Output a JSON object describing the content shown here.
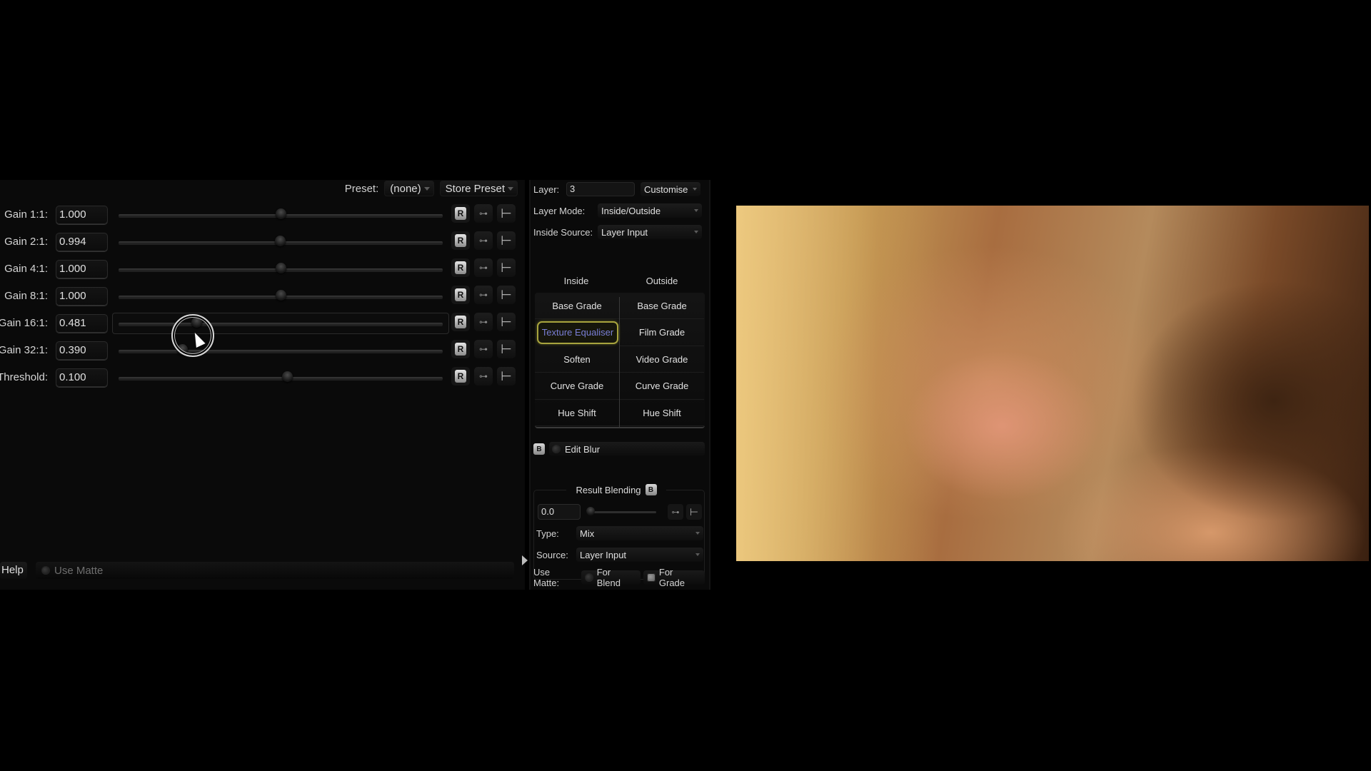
{
  "effect_panel": {
    "preset_label": "Preset:",
    "preset_value": "(none)",
    "store_preset_label": "Store Preset",
    "params": [
      {
        "label": "Gain 1:1:",
        "value": "1.000",
        "slider_fraction": 0.5
      },
      {
        "label": "Gain 2:1:",
        "value": "0.994",
        "slider_fraction": 0.497
      },
      {
        "label": "Gain 4:1:",
        "value": "1.000",
        "slider_fraction": 0.5
      },
      {
        "label": "Gain 8:1:",
        "value": "1.000",
        "slider_fraction": 0.5
      },
      {
        "label": "Gain 16:1:",
        "value": "0.481",
        "slider_fraction": 0.24,
        "active": true
      },
      {
        "label": "Gain 32:1:",
        "value": "0.390",
        "slider_fraction": 0.195
      },
      {
        "label": "Threshold:",
        "value": "0.100",
        "slider_fraction": 0.52
      }
    ],
    "reset_button_label": "R",
    "help_label": "Help",
    "use_matte_label": "Use Matte"
  },
  "layer_panel": {
    "layer_label": "Layer:",
    "layer_value": "3",
    "customise_label": "Customise",
    "layer_mode_label": "Layer Mode:",
    "layer_mode_value": "Inside/Outside",
    "inside_source_label": "Inside Source:",
    "inside_source_value": "Layer Input",
    "columns": [
      "Inside",
      "Outside"
    ],
    "inside_items": [
      "Base Grade",
      "Texture Equaliser",
      "Soften",
      "Curve Grade",
      "Hue Shift"
    ],
    "outside_items": [
      "Base Grade",
      "Film Grade",
      "Video Grade",
      "Curve Grade",
      "Hue Shift"
    ],
    "selected_item": "Texture Equaliser",
    "bypass_badge": "B",
    "edit_blur_label": "Edit Blur",
    "result_blending": {
      "title": "Result Blending",
      "value": "0.0",
      "slider_fraction": 0.0,
      "type_label": "Type:",
      "type_value": "Mix",
      "source_label": "Source:",
      "source_value": "Layer Input"
    },
    "use_matte_label": "Use Matte:",
    "for_blend_label": "For Blend",
    "for_grade_label": "For Grade"
  },
  "colors": {
    "selection_outline": "#a8a43e",
    "selection_text": "#7a7fd6",
    "panel_bg": "#0a0a0a"
  },
  "icons": {
    "key": "⊶",
    "graph": "⊢"
  }
}
